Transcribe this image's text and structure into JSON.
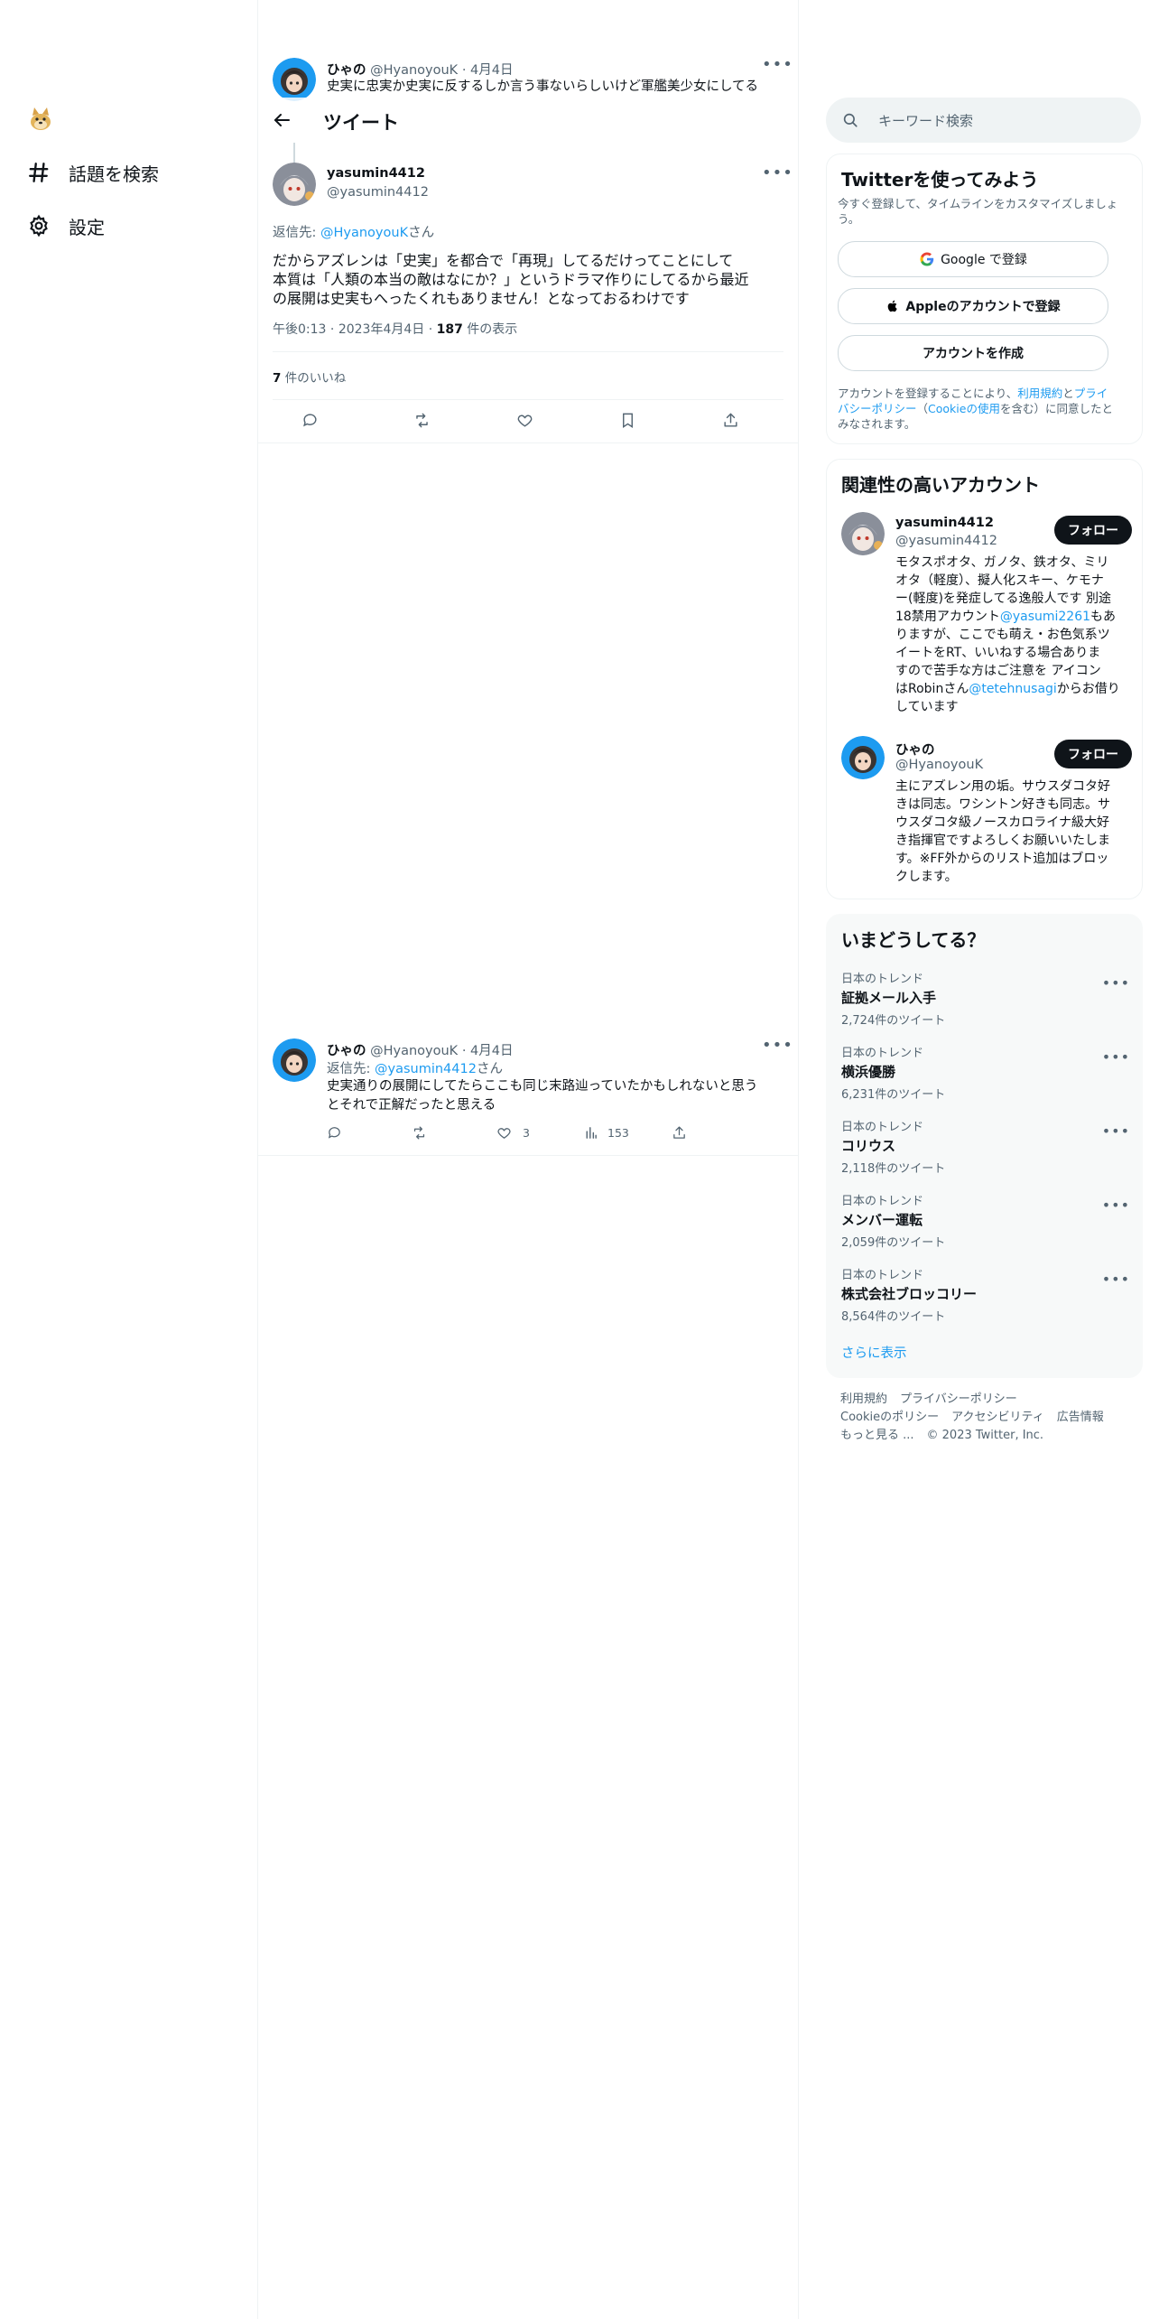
{
  "nav": {
    "items": [
      {
        "label": "話題を検索",
        "icon": "hashtag-icon"
      },
      {
        "label": "設定",
        "icon": "gear-icon"
      }
    ]
  },
  "header": {
    "title": "ツイート"
  },
  "parent_tweet": {
    "display_name": "ひゃの",
    "handle": "@HyanoyouK",
    "date": "4月4日",
    "sep": "·",
    "text": "史実に忠実か史実に反するしか言う事ないらしいけど軍艦美少女にしてる"
  },
  "main_tweet": {
    "display_name": "yasumin4412",
    "handle": "@yasumin4412",
    "reply_prefix": "返信先: ",
    "reply_to": "@HyanoyouK",
    "reply_suffix": "さん",
    "text_lines": [
      "だからアズレンは「史実」を都合で「再現」してるだけってことにして",
      "本質は「人類の本当の敵はなにか？」というドラマ作りにしてるから最近",
      "の展開は史実もへったくれもありません！となっておるわけです"
    ],
    "time": "午後0:13",
    "date": "2023年4月4日",
    "views_count": "187",
    "views_label": " 件の表示",
    "likes_count": "7",
    "likes_label": " 件のいいね"
  },
  "reply_tweet": {
    "display_name": "ひゃの",
    "handle": "@HyanoyouK",
    "date": "4月4日",
    "reply_prefix": "返信先: ",
    "reply_to": "@yasumin4412",
    "reply_suffix": "さん",
    "text_lines": [
      "史実通りの展開にしてたらここも同じ末路辿っていたかもしれないと思う",
      "とそれで正解だったと思える"
    ],
    "likes": "3",
    "views": "153"
  },
  "search": {
    "placeholder": "キーワード検索"
  },
  "signup": {
    "title": "Twitterを使ってみよう",
    "subtitle_lines": [
      "今すぐ登録して、タイムラインをカスタマイズしましょ",
      "う。"
    ],
    "google_label": "Google で登録",
    "apple_label": "Appleのアカウントで登録",
    "create_label": "アカウントを作成",
    "legal_1": "アカウントを登録することにより、",
    "legal_terms": "利用規約",
    "legal_and": "と",
    "legal_privacy_a": "プライ",
    "legal_privacy_b": "バシーポリシー",
    "legal_paren_open": "（",
    "legal_cookie": "Cookieの使用",
    "legal_2": "を含む）に同意したと",
    "legal_3": "みなされます。"
  },
  "related": {
    "title": "関連性の高いアカウント",
    "follow_label": "フォロー",
    "accounts": [
      {
        "name": "yasumin4412",
        "handle": "@yasumin4412",
        "bio_lines": [
          "モタスポオタ、ガノタ、鉄オタ、ミリ",
          "オタ（軽度）、擬人化スキー、ケモナ",
          "ー(軽度)を発症してる逸般人です 別途",
          "18禁用アカウント",
          "りますが、ここでも萌え・お色気系ツ",
          "イートをRT、いいねする場合ありま",
          "すので苦手な方はご注意を アイコン",
          "はRobinさん",
          "しています"
        ],
        "bio_mention_1": "@yasumi2261",
        "bio_after_1": "もあ",
        "bio_mention_2": "@tetehnusagi",
        "bio_after_2": "からお借り"
      },
      {
        "name": "ひゃの",
        "handle": "@HyanoyouK",
        "bio_lines": [
          "主にアズレン用の垢。サウスダコタ好",
          "きは同志。ワシントン好きも同志。サ",
          "ウスダコタ級ノースカロライナ級大好",
          "き指揮官ですよろしくお願いいたしま",
          "す。※FF外からのリスト追加はブロッ",
          "クします。"
        ]
      }
    ]
  },
  "trends": {
    "title": "いまどうしてる？",
    "items": [
      {
        "context": "日本のトレンド",
        "topic": "証拠メール入手",
        "count": "2,724件のツイート"
      },
      {
        "context": "日本のトレンド",
        "topic": "横浜優勝",
        "count": "6,231件のツイート"
      },
      {
        "context": "日本のトレンド",
        "topic": "コリウス",
        "count": "2,118件のツイート"
      },
      {
        "context": "日本のトレンド",
        "topic": "メンバー運転",
        "count": "2,059件のツイート"
      },
      {
        "context": "日本のトレンド",
        "topic": "株式会社ブロッコリー",
        "count": "8,564件のツイート"
      }
    ],
    "show_more": "さらに表示"
  },
  "footer": {
    "line1": [
      "利用規約",
      "プライバシーポリシー"
    ],
    "line2": [
      "Cookieのポリシー",
      "アクセシビリティ",
      "広告情報"
    ],
    "more": "もっと見る ...",
    "copyright": "© 2023 Twitter, Inc."
  },
  "colors": {
    "accent": "#1d9bf0",
    "text": "#0f1419",
    "muted": "#536471",
    "border": "#eff3f4"
  }
}
